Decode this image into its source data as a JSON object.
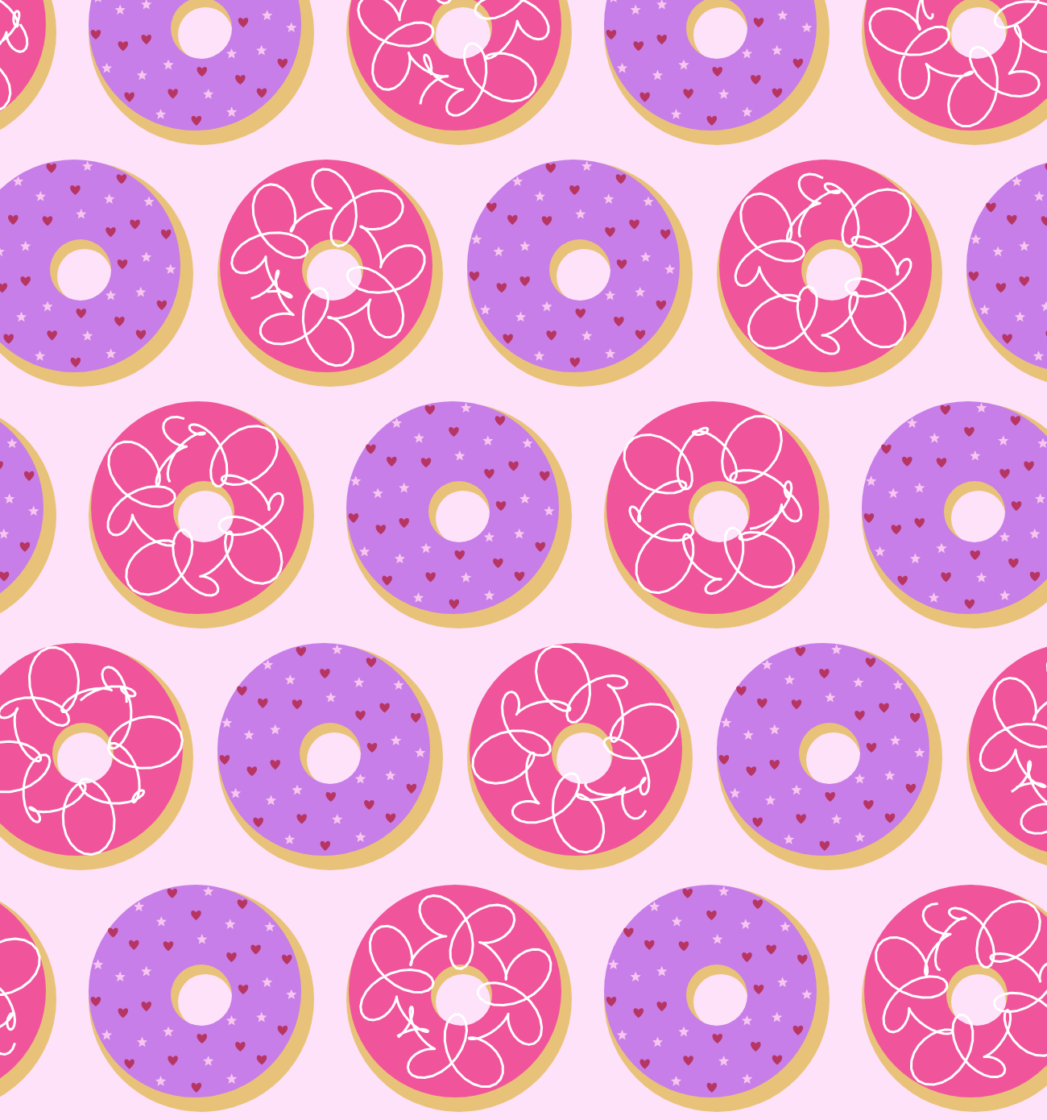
{
  "pattern": {
    "rows": [
      {
        "donuts": [
          {
            "kind": "pink-drizzle"
          },
          {
            "kind": "purple-sprinkles"
          },
          {
            "kind": "pink-drizzle"
          },
          {
            "kind": "purple-sprinkles"
          },
          {
            "kind": "pink-drizzle"
          }
        ]
      },
      {
        "donuts": [
          {
            "kind": "purple-sprinkles"
          },
          {
            "kind": "pink-drizzle"
          },
          {
            "kind": "purple-sprinkles"
          },
          {
            "kind": "pink-drizzle"
          },
          {
            "kind": "purple-sprinkles"
          }
        ]
      },
      {
        "donuts": [
          {
            "kind": "purple-sprinkles"
          },
          {
            "kind": "pink-drizzle"
          },
          {
            "kind": "purple-sprinkles"
          },
          {
            "kind": "pink-drizzle"
          },
          {
            "kind": "purple-sprinkles"
          }
        ]
      },
      {
        "donuts": [
          {
            "kind": "pink-drizzle"
          },
          {
            "kind": "purple-sprinkles"
          },
          {
            "kind": "pink-drizzle"
          },
          {
            "kind": "purple-sprinkles"
          },
          {
            "kind": "pink-drizzle"
          }
        ]
      },
      {
        "donuts": [
          {
            "kind": "pink-drizzle"
          },
          {
            "kind": "purple-sprinkles"
          },
          {
            "kind": "pink-drizzle"
          },
          {
            "kind": "purple-sprinkles"
          },
          {
            "kind": "pink-drizzle"
          }
        ]
      }
    ]
  }
}
